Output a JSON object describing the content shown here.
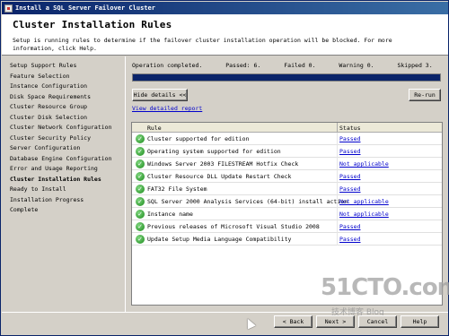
{
  "window": {
    "title": "Install a SQL Server Failover Cluster"
  },
  "header": {
    "title": "Cluster Installation Rules",
    "description": "Setup is running rules to determine if the failover cluster installation operation will be blocked. For more information, click Help."
  },
  "sidebar": {
    "items": [
      {
        "label": "Setup Support Rules"
      },
      {
        "label": "Feature Selection"
      },
      {
        "label": "Instance Configuration"
      },
      {
        "label": "Disk Space Requirements"
      },
      {
        "label": "Cluster Resource Group"
      },
      {
        "label": "Cluster Disk Selection"
      },
      {
        "label": "Cluster Network Configuration"
      },
      {
        "label": "Cluster Security Policy"
      },
      {
        "label": "Server Configuration"
      },
      {
        "label": "Database Engine Configuration"
      },
      {
        "label": "Error and Usage Reporting"
      },
      {
        "label": "Cluster Installation Rules",
        "active": true
      },
      {
        "label": "Ready to Install"
      },
      {
        "label": "Installation Progress"
      },
      {
        "label": "Complete"
      }
    ]
  },
  "summary": {
    "operation": "Operation completed.",
    "passed": "Passed: 6.",
    "failed": "Failed 0.",
    "warning": "Warning 0.",
    "skipped": "Skipped 3.",
    "progress_fraction": 1.0
  },
  "buttons": {
    "hide_details": "Hide details <<",
    "rerun": "Re-run",
    "back": "< Back",
    "next": "Next >",
    "cancel": "Cancel",
    "help": "Help"
  },
  "view_report": "View detailed report",
  "grid": {
    "headers": {
      "rule": "Rule",
      "status": "Status"
    },
    "rows": [
      {
        "rule": "Cluster supported for edition",
        "status": "Passed"
      },
      {
        "rule": "Operating system supported for edition",
        "status": "Passed"
      },
      {
        "rule": "Windows Server 2003 FILESTREAM Hotfix Check",
        "status": "Not applicable"
      },
      {
        "rule": "Cluster Resource DLL Update Restart Check",
        "status": "Passed"
      },
      {
        "rule": "FAT32 File System",
        "status": "Passed"
      },
      {
        "rule": "SQL Server 2000 Analysis Services (64-bit) install action",
        "status": "Not applicable"
      },
      {
        "rule": "Instance name",
        "status": "Not applicable"
      },
      {
        "rule": "Previous releases of Microsoft Visual Studio 2008",
        "status": "Passed"
      },
      {
        "rule": "Update Setup Media Language Compatibility",
        "status": "Passed"
      }
    ]
  },
  "watermark": {
    "brand": "51CTO.com",
    "sub": "技术博客 Blog"
  },
  "colors": {
    "title_bar": "#0a246a",
    "link": "#0000cc",
    "check_green": "#1c8a1c"
  }
}
